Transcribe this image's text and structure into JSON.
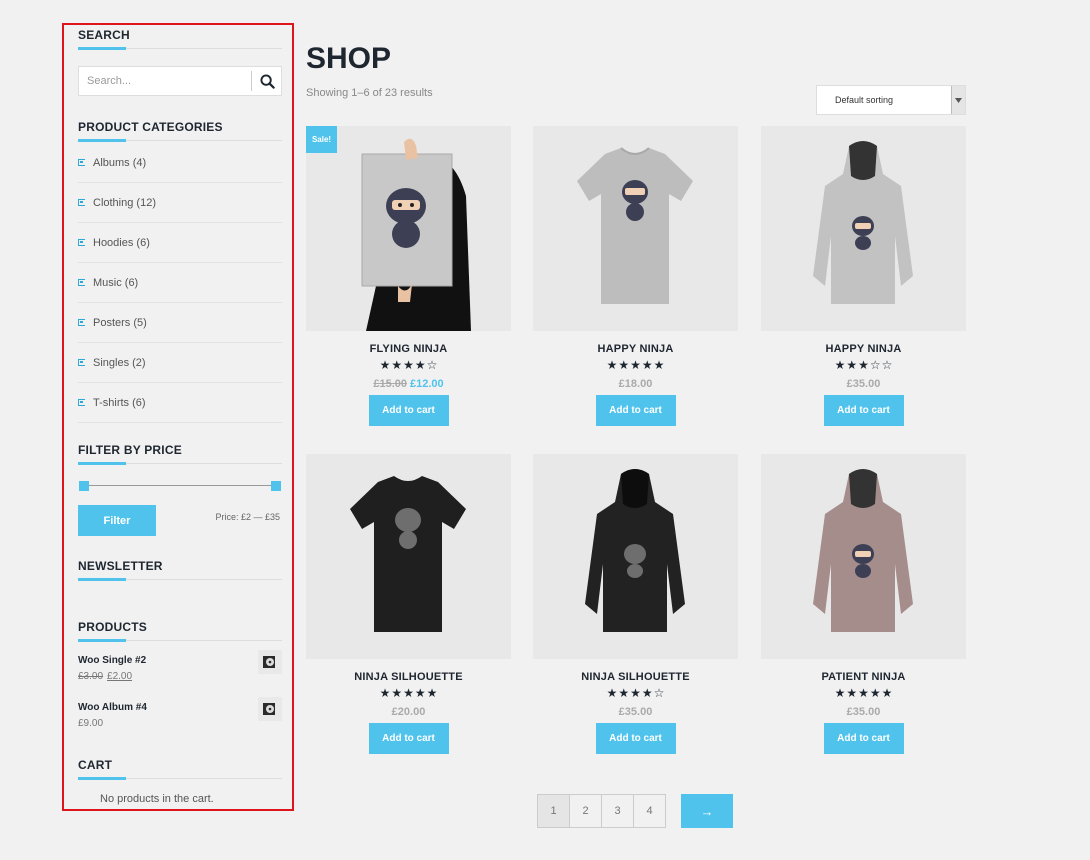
{
  "colors": {
    "accent": "#4fc3ec",
    "highlight_border": "#e0141c",
    "heading": "#1e2630"
  },
  "sidebar": {
    "search": {
      "title": "SEARCH",
      "placeholder": "Search...",
      "icon": "search-icon"
    },
    "categories": {
      "title": "PRODUCT CATEGORIES",
      "items": [
        {
          "label": "Albums (4)"
        },
        {
          "label": "Clothing (12)"
        },
        {
          "label": "Hoodies (6)"
        },
        {
          "label": "Music (6)"
        },
        {
          "label": "Posters (5)"
        },
        {
          "label": "Singles (2)"
        },
        {
          "label": "T-shirts (6)"
        }
      ]
    },
    "price_filter": {
      "title": "FILTER BY PRICE",
      "button": "Filter",
      "range_label": "Price: £2 — £35",
      "min_fraction": 0,
      "max_fraction": 1
    },
    "newsletter": {
      "title": "NEWSLETTER"
    },
    "products": {
      "title": "PRODUCTS",
      "items": [
        {
          "name": "Woo Single #2",
          "old_price": "£3.00",
          "price": "£2.00"
        },
        {
          "name": "Woo Album #4",
          "price": "£9.00"
        }
      ]
    },
    "cart": {
      "title": "CART",
      "empty_text": "No products in the cart."
    }
  },
  "main": {
    "title": "SHOP",
    "result_count": "Showing 1–6 of 23 results",
    "sort": {
      "selected": "Default sorting"
    },
    "products": [
      {
        "name": "FLYING NINJA",
        "rating": 4,
        "old_price": "£15.00",
        "price": "£12.00",
        "sale": "Sale!",
        "button": "Add to cart"
      },
      {
        "name": "HAPPY NINJA",
        "rating": 5,
        "price": "£18.00",
        "button": "Add to cart"
      },
      {
        "name": "HAPPY NINJA",
        "rating": 3,
        "price": "£35.00",
        "button": "Add to cart"
      },
      {
        "name": "NINJA SILHOUETTE",
        "rating": 5,
        "price": "£20.00",
        "button": "Add to cart"
      },
      {
        "name": "NINJA SILHOUETTE",
        "rating": 4,
        "price": "£35.00",
        "button": "Add to cart"
      },
      {
        "name": "PATIENT NINJA",
        "rating": 5,
        "price": "£35.00",
        "button": "Add to cart"
      }
    ],
    "pagination": {
      "pages": [
        "1",
        "2",
        "3",
        "4"
      ],
      "current": "1",
      "next": "→"
    }
  }
}
